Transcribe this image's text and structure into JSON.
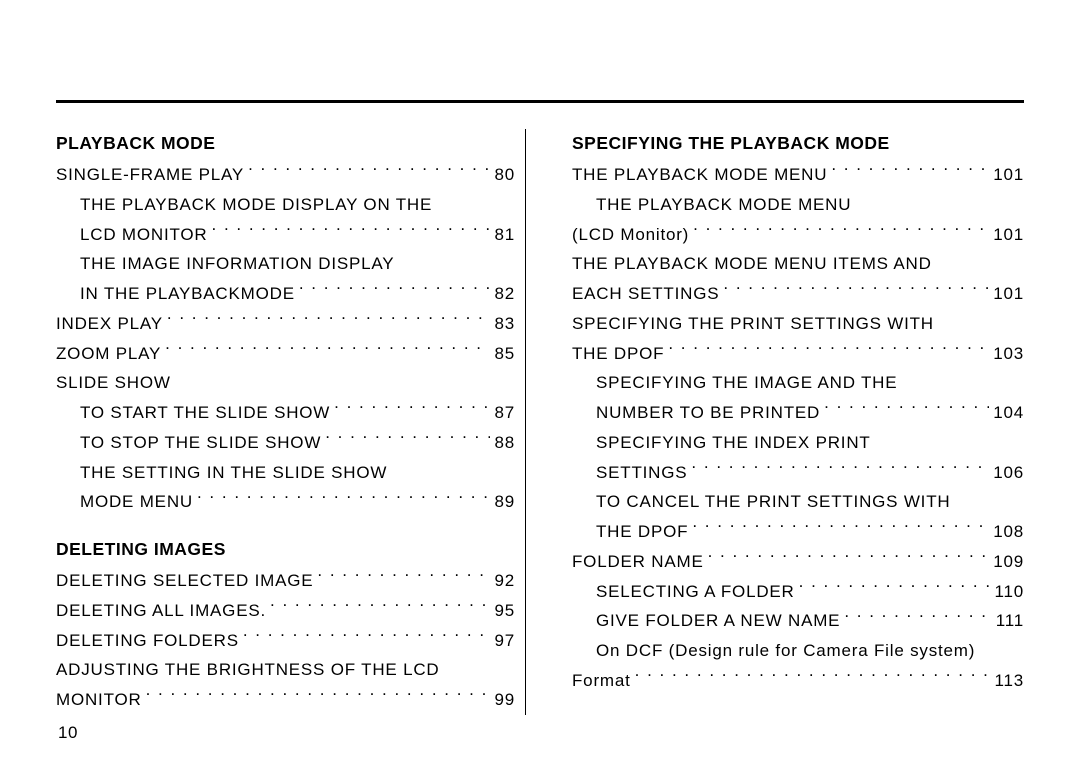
{
  "page_number": "10",
  "left": {
    "section1": {
      "heading": "PLAYBACK MODE",
      "items": [
        {
          "label": "SINGLE-FRAME PLAY",
          "page": "80",
          "indent": 0
        },
        {
          "label": "THE PLAYBACK MODE DISPLAY ON THE",
          "page": "",
          "indent": 1,
          "nopage": true
        },
        {
          "label": "LCD MONITOR",
          "page": "81",
          "indent": 1
        },
        {
          "label": "THE IMAGE INFORMATION DISPLAY",
          "page": "",
          "indent": 1,
          "nopage": true
        },
        {
          "label": "IN THE PLAYBACKMODE",
          "page": "82",
          "indent": 1
        },
        {
          "label": "INDEX PLAY",
          "page": "83",
          "indent": 0
        },
        {
          "label": "ZOOM PLAY",
          "page": "85",
          "indent": 0
        },
        {
          "label": "SLIDE SHOW",
          "page": "",
          "indent": 0,
          "nopage": true
        },
        {
          "label": "TO START THE SLIDE SHOW",
          "page": "87",
          "indent": 1
        },
        {
          "label": "TO STOP THE SLIDE SHOW",
          "page": "88",
          "indent": 1
        },
        {
          "label": "THE SETTING IN THE SLIDE SHOW",
          "page": "",
          "indent": 1,
          "nopage": true
        },
        {
          "label": "MODE MENU",
          "page": "89",
          "indent": 1
        }
      ]
    },
    "section2": {
      "heading": "DELETING IMAGES",
      "items": [
        {
          "label": "DELETING SELECTED IMAGE",
          "page": "92",
          "indent": 0
        },
        {
          "label": "DELETING ALL IMAGES.",
          "page": "95",
          "indent": 0
        },
        {
          "label": "DELETING  FOLDERS",
          "page": "97",
          "indent": 0
        },
        {
          "label": "ADJUSTING THE BRIGHTNESS OF THE LCD",
          "page": "",
          "indent": 0,
          "nopage": true
        },
        {
          "label": "MONITOR",
          "page": "99",
          "indent": 0
        }
      ]
    }
  },
  "right": {
    "section1": {
      "heading": "SPECIFYING THE PLAYBACK MODE",
      "items": [
        {
          "label": "THE PLAYBACK MODE MENU",
          "page": "101",
          "indent": 0
        },
        {
          "label": "THE PLAYBACK MODE MENU",
          "page": "",
          "indent": 1,
          "nopage": true
        },
        {
          "label": "(LCD Monitor)",
          "page": "101",
          "indent": 0
        },
        {
          "label": "THE PLAYBACK MODE MENU ITEMS AND",
          "page": "",
          "indent": 0,
          "nopage": true
        },
        {
          "label": "EACH SETTINGS",
          "page": "101",
          "indent": 0
        },
        {
          "label": "SPECIFYING THE PRINT SETTINGS WITH",
          "page": "",
          "indent": 0,
          "nopage": true
        },
        {
          "label": "THE DPOF",
          "page": "103",
          "indent": 0
        },
        {
          "label": "SPECIFYING THE IMAGE AND THE",
          "page": "",
          "indent": 1,
          "nopage": true
        },
        {
          "label": "NUMBER TO BE PRINTED",
          "page": "104",
          "indent": 1
        },
        {
          "label": "SPECIFYING THE INDEX PRINT",
          "page": "",
          "indent": 1,
          "nopage": true
        },
        {
          "label": "SETTINGS",
          "page": "106",
          "indent": 1
        },
        {
          "label": "TO CANCEL THE PRINT SETTINGS WITH",
          "page": "",
          "indent": 1,
          "nopage": true
        },
        {
          "label": "THE DPOF",
          "page": "108",
          "indent": 1
        },
        {
          "label": "FOLDER NAME",
          "page": "109",
          "indent": 0
        },
        {
          "label": "SELECTING A FOLDER",
          "page": "110",
          "indent": 1
        },
        {
          "label": "GIVE FOLDER A NEW NAME",
          "page": "111",
          "indent": 1
        },
        {
          "label": "On DCF (Design rule for Camera File system)",
          "page": "",
          "indent": 1,
          "nopage": true,
          "normalcase": true
        },
        {
          "label": "Format",
          "page": "113",
          "indent": 0,
          "normalcase": true
        }
      ]
    }
  }
}
